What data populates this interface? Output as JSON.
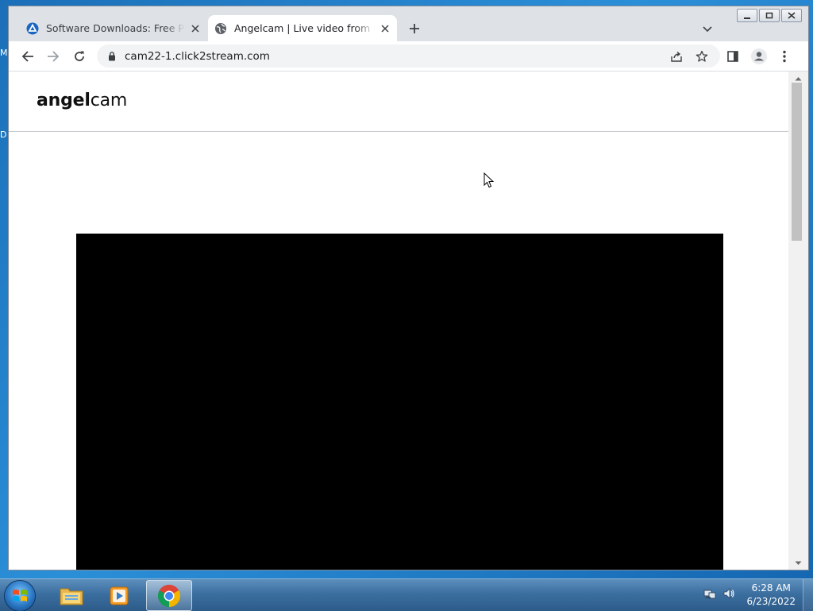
{
  "desktop": {
    "edge_labels": [
      "M",
      "D"
    ]
  },
  "browser": {
    "tabs": [
      {
        "title": "Software Downloads: Free Progra",
        "active": false,
        "favicon": "download-site-favicon-icon"
      },
      {
        "title": "Angelcam | Live video from LQ-C",
        "active": true,
        "favicon": "globe-icon"
      }
    ],
    "url": "cam22-1.click2stream.com",
    "icons": {
      "back": "arrow-left-icon",
      "forward": "arrow-right-icon",
      "reload": "reload-icon",
      "lock": "lock-icon",
      "share": "share-icon",
      "bookmark": "star-icon",
      "side_panel": "side-panel-icon",
      "profile": "profile-icon",
      "menu": "kebab-menu-icon",
      "new_tab": "plus-icon",
      "tab_search": "chevron-down-icon"
    }
  },
  "page": {
    "logo_bold": "angel",
    "logo_light": "cam",
    "video_background": "#000000"
  },
  "taskbar": {
    "items": [
      {
        "name": "windows-explorer",
        "icon": "folder-icon",
        "active": false
      },
      {
        "name": "media-player",
        "icon": "media-player-icon",
        "active": false
      },
      {
        "name": "google-chrome",
        "icon": "chrome-icon",
        "active": true
      }
    ],
    "time": "6:28 AM",
    "date": "6/23/2022"
  },
  "colors": {
    "desktop": "#1f78c5",
    "tabstrip": "#dee1e6",
    "omnibox": "#f1f3f4",
    "taskbar": "#3b6fa0"
  }
}
